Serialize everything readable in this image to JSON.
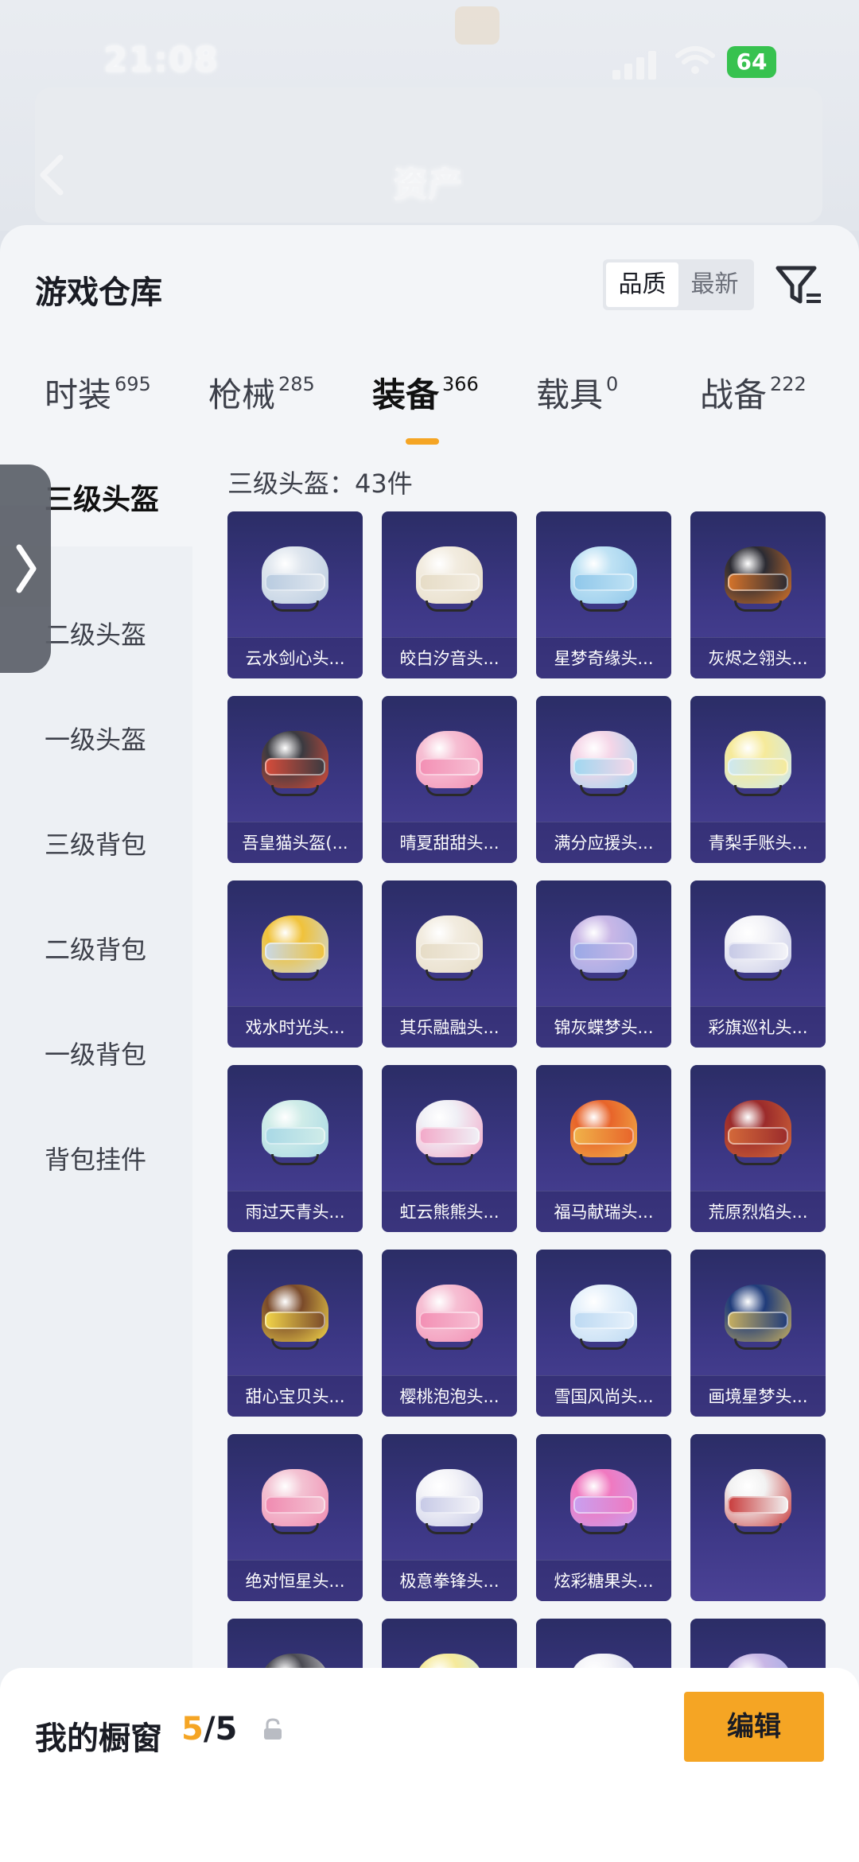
{
  "status_bar": {
    "time": "21:08",
    "battery": "64"
  },
  "header": {
    "title": "资产"
  },
  "warehouse": {
    "title": "游戏仓库",
    "sort_options": [
      "品质",
      "最新"
    ],
    "active_sort": "品质"
  },
  "tabs": [
    {
      "label": "时装",
      "count": "695"
    },
    {
      "label": "枪械",
      "count": "285"
    },
    {
      "label": "装备",
      "count": "366",
      "active": true
    },
    {
      "label": "载具",
      "count": "0"
    },
    {
      "label": "战备",
      "count": "222"
    }
  ],
  "sidebar": {
    "items": [
      "三级头盔",
      "二级头盔",
      "一级头盔",
      "三级背包",
      "二级背包",
      "一级背包",
      "背包挂件"
    ],
    "active": "三级头盔"
  },
  "grid": {
    "count_label": "三级头盔：43件",
    "items": [
      {
        "label": "云水剑心头...",
        "tone": "silver"
      },
      {
        "label": "皎白汐音头...",
        "tone": "cream"
      },
      {
        "label": "星梦奇缘头...",
        "tone": "blue"
      },
      {
        "label": "灰烬之翎头...",
        "tone": "black"
      },
      {
        "label": "吾皇猫头盔(...",
        "tone": "catblack"
      },
      {
        "label": "晴夏甜甜头...",
        "tone": "pink"
      },
      {
        "label": "满分应援头...",
        "tone": "pastel"
      },
      {
        "label": "青梨手账头...",
        "tone": "yellow"
      },
      {
        "label": "戏水时光头...",
        "tone": "gold"
      },
      {
        "label": "其乐融融头...",
        "tone": "cream"
      },
      {
        "label": "锦灰蝶梦头...",
        "tone": "lilac"
      },
      {
        "label": "彩旗巡礼头...",
        "tone": "white"
      },
      {
        "label": "雨过天青头...",
        "tone": "mint"
      },
      {
        "label": "虹云熊熊头...",
        "tone": "rainbow"
      },
      {
        "label": "福马献瑞头...",
        "tone": "orange"
      },
      {
        "label": "荒原烈焰头...",
        "tone": "red"
      },
      {
        "label": "甜心宝贝头...",
        "tone": "choco"
      },
      {
        "label": "樱桃泡泡头...",
        "tone": "pink"
      },
      {
        "label": "雪国风尚头...",
        "tone": "icewhite"
      },
      {
        "label": "画境星梦头...",
        "tone": "navy"
      },
      {
        "label": "绝对恒星头...",
        "tone": "rose"
      },
      {
        "label": "极意拳锋头...",
        "tone": "white"
      },
      {
        "label": "炫彩糖果头...",
        "tone": "magenta"
      },
      {
        "label": "",
        "tone": "redwhite"
      },
      {
        "label": "",
        "tone": "dark"
      },
      {
        "label": "",
        "tone": "yellow"
      },
      {
        "label": "",
        "tone": "white"
      },
      {
        "label": "",
        "tone": "lilac"
      }
    ]
  },
  "bottom": {
    "label": "我的橱窗",
    "current": "5",
    "total": "/5",
    "edit_label": "编辑"
  }
}
